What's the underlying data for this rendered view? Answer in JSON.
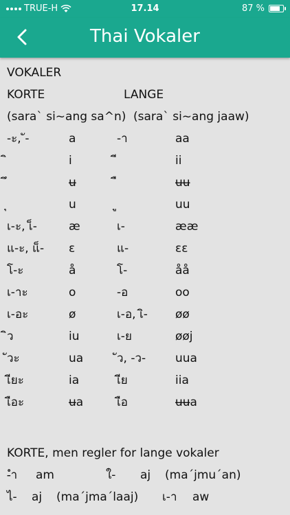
{
  "status": {
    "carrier": "TRUE-H",
    "time": "17.14",
    "battery": "87 %",
    "battery_level": 0.87
  },
  "nav": {
    "title": "Thai Vokaler"
  },
  "content": {
    "heading": "VOKALER",
    "col_short": "KORTE",
    "col_long": "LANGE",
    "sub_short": "(sara` si~ang sa^n)",
    "sub_long": "(sara` si~ang jaaw)",
    "rows": [
      [
        "-ะ, ั-",
        "a",
        "-า",
        "aa"
      ],
      [
        "ิ",
        "i",
        "ี",
        "ii"
      ],
      [
        "ึ",
        "ʉ",
        "ื",
        "ʉʉ"
      ],
      [
        "ุ",
        "u",
        "ู",
        "uu"
      ],
      [
        "เ-ะ, เ็-",
        "æ",
        "เ-",
        "ææ"
      ],
      [
        "แ-ะ, แ็-",
        "ε",
        "แ-",
        "εε"
      ],
      [
        "โ-ะ",
        "å",
        "โ-",
        "åå"
      ],
      [
        "เ-าะ",
        "o",
        "-อ",
        "oo"
      ],
      [
        "เ-อะ",
        "ø",
        "เ-อ, เิ-",
        "øø"
      ],
      [
        "ิว",
        "iu",
        "เ-ย",
        "øøj"
      ],
      [
        "ัวะ",
        "ua",
        "ัว, -ว-",
        "uua"
      ],
      [
        "เียะ",
        "ia",
        "เีย",
        "iia"
      ],
      [
        "เือะ",
        "ʉa",
        "เือ",
        "ʉʉa"
      ]
    ],
    "note_heading": "KORTE, men regler for lange vokaler",
    "note_rows": [
      {
        "a": "-ำ",
        "b": "am",
        "c": "ใ-",
        "d": "aj",
        "e": "(ma´jmu´an)"
      },
      {
        "a": "ไ-",
        "b": "aj",
        "c": "(ma´jma´laaj)",
        "d": "เ-า",
        "e": "aw"
      }
    ]
  }
}
